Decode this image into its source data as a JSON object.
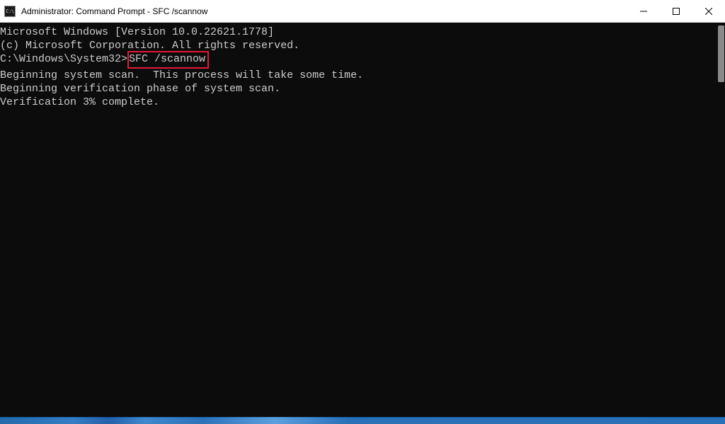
{
  "titlebar": {
    "icon_text": "C:\\",
    "title": "Administrator: Command Prompt - SFC  /scannow"
  },
  "terminal": {
    "line1": "Microsoft Windows [Version 10.0.22621.1778]",
    "line2": "(c) Microsoft Corporation. All rights reserved.",
    "blank1": "",
    "prompt_prefix": "C:\\Windows\\System32>",
    "prompt_command": "SFC /scannow",
    "blank2": "",
    "line3": "Beginning system scan.  This process will take some time.",
    "blank3": "",
    "line4": "Beginning verification phase of system scan.",
    "line5": "Verification 3% complete."
  }
}
